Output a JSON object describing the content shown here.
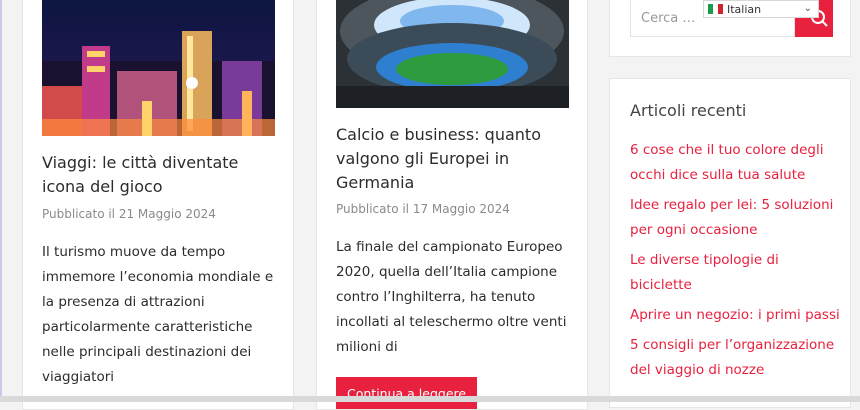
{
  "posts": [
    {
      "title": "Viaggi: le città diventate icona del gioco",
      "date": "Pubblicato il 21 Maggio 2024",
      "excerpt": "Il turismo muove da tempo immemore l’economia mondiale e la presenza di attrazioni particolarmente caratteristiche nelle principali destinazioni dei viaggiatori",
      "image_icon": "city-night-image"
    },
    {
      "title": "Calcio e business: quanto valgono gli Europei in Germania",
      "date": "Pubblicato il 17 Maggio 2024",
      "excerpt": "La finale del campionato Europeo 2020, quella dell’Italia campione contro l’Inghilterra, ha tenuto incollati al teleschermo oltre venti milioni di",
      "read_more": "Continua a leggere",
      "image_icon": "stadium-image"
    }
  ],
  "sidebar": {
    "search": {
      "placeholder": "Cerca …",
      "button_icon": "search-icon"
    },
    "language": {
      "selected": "Italian",
      "flag": "italy-flag-icon"
    },
    "recent": {
      "title": "Articoli recenti",
      "items": [
        "6 cose che il tuo colore degli occhi dice sulla tua salute",
        "Idee regalo per lei: 5 soluzioni per ogni occasione",
        "Le diverse tipologie di biciclette",
        "Aprire un negozio: i primi passi",
        "5 consigli per l’organizzazione del viaggio di nozze"
      ]
    }
  },
  "colors": {
    "accent": "#e8213f",
    "text": "#2c2c2c",
    "muted": "#8a8a8a"
  }
}
